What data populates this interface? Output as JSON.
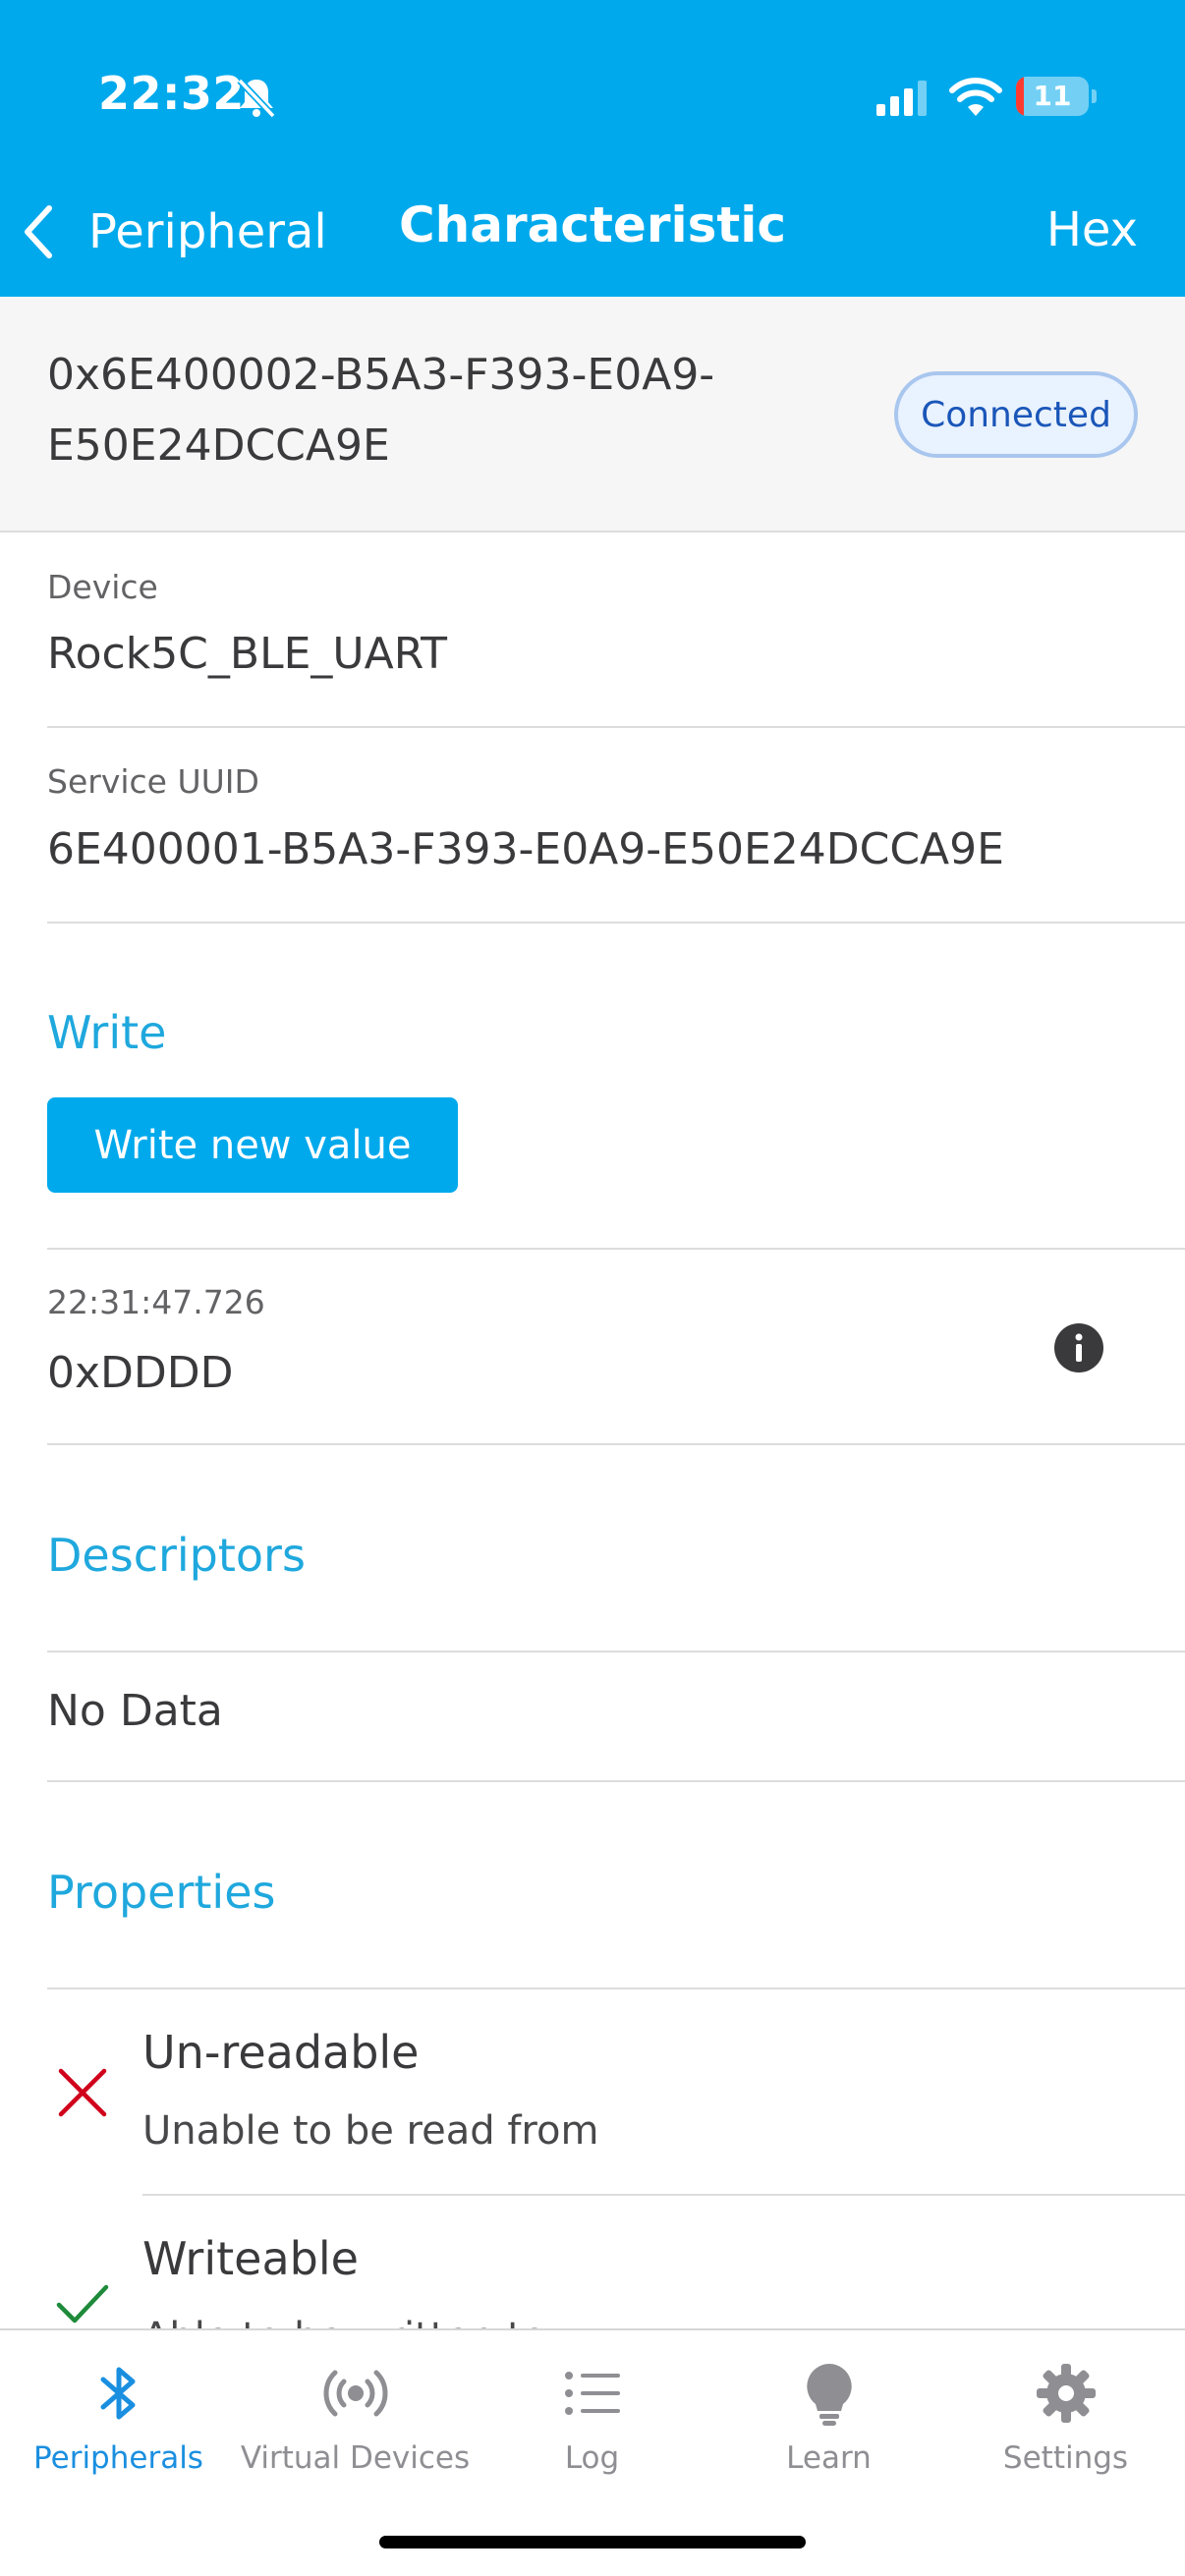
{
  "status_bar": {
    "time": "22:32",
    "battery_level": "11",
    "icons": [
      "bell-slash-icon",
      "cellular-signal-icon",
      "wifi-icon",
      "battery-icon"
    ]
  },
  "nav": {
    "back_label": "Peripheral",
    "title": "Characteristic",
    "right_action": "Hex"
  },
  "characteristic": {
    "uuid_line1": "0x6E400002-B5A3-F393-E0A9-",
    "uuid_line2": "E50E24DCCA9E",
    "status": "Connected"
  },
  "device": {
    "label": "Device",
    "value": "Rock5C_BLE_UART"
  },
  "service": {
    "label": "Service UUID",
    "value": "6E400001-B5A3-F393-E0A9-E50E24DCCA9E"
  },
  "write": {
    "section_title": "Write",
    "button_label": "Write new value",
    "last_entry": {
      "timestamp": "22:31:47.726",
      "value": "0xDDDD"
    }
  },
  "descriptors": {
    "section_title": "Descriptors",
    "empty_text": "No Data"
  },
  "properties": {
    "section_title": "Properties",
    "items": [
      {
        "title": "Un-readable",
        "description": "Unable to be read from",
        "icon": "cross-icon",
        "color": "#d0021b"
      },
      {
        "title": "Writeable",
        "description": "Able to be written to",
        "icon": "checkmark-icon",
        "color": "#1e8a3a"
      }
    ]
  },
  "tabbar": {
    "accent_color": "#1a8fe0",
    "tabs": [
      {
        "label": "Peripherals",
        "icon": "bluetooth-icon",
        "active": true
      },
      {
        "label": "Virtual Devices",
        "icon": "broadcast-icon",
        "active": false
      },
      {
        "label": "Log",
        "icon": "list-icon",
        "active": false
      },
      {
        "label": "Learn",
        "icon": "lightbulb-icon",
        "active": false
      },
      {
        "label": "Settings",
        "icon": "gear-icon",
        "active": false
      }
    ]
  },
  "colors": {
    "header_blue": "#00a9ec",
    "section_title_blue": "#1fa8dd",
    "connected_badge_text": "#1a56b8"
  }
}
